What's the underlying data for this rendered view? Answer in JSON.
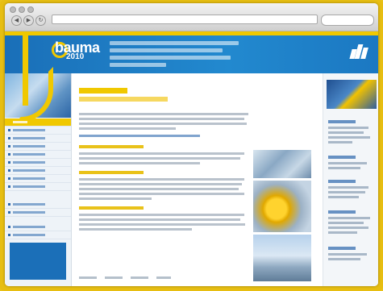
{
  "colors": {
    "frame": "#e7be12",
    "banner_blue": "#1f7fc6",
    "accent_yellow": "#f0c800",
    "link_blue": "#2b67ad"
  },
  "browser": {
    "window_title": "",
    "url": "",
    "icons": [
      "back-icon",
      "forward-icon",
      "reload-icon"
    ]
  },
  "site": {
    "logo_name": "bauma",
    "logo_year": "2010"
  },
  "sidebar": {
    "items": [
      "",
      "",
      "",
      "",
      "",
      "",
      "",
      "",
      "",
      "",
      "",
      "",
      ""
    ],
    "box_title": "",
    "box_subtitle": ""
  },
  "main": {
    "heading": "",
    "subheading": ""
  }
}
